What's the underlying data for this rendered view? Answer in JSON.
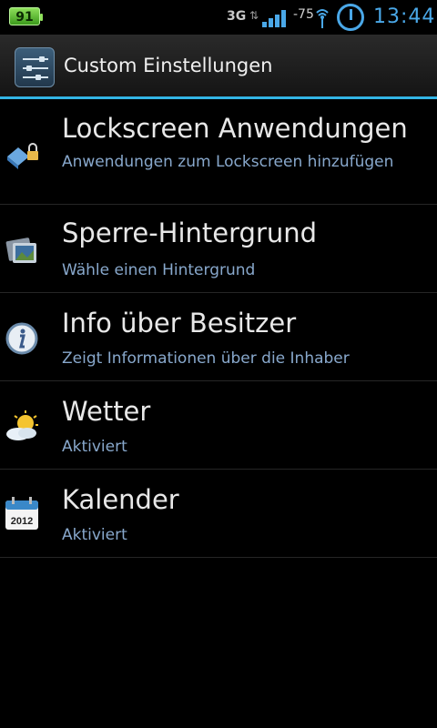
{
  "status_bar": {
    "battery": "91",
    "network_type": "3G",
    "signal_dbm": "-75",
    "time": "13:44",
    "icons": [
      "battery-icon",
      "data-arrows-icon",
      "signal-icon",
      "wifi-icon",
      "clock-widget-icon"
    ]
  },
  "header": {
    "title": "Custom Einstellungen",
    "icon": "settings-sliders-icon",
    "accent_color": "#33b5e5"
  },
  "settings": {
    "items": [
      {
        "title": "Lockscreen Anwendungen",
        "subtitle": "Anwendungen zum Lockscreen hinzufügen",
        "icon": "lockscreen-apps-icon"
      },
      {
        "title": "Sperre-Hintergrund",
        "subtitle": "Wähle einen Hintergrund",
        "icon": "wallpaper-icon"
      },
      {
        "title": "Info über Besitzer",
        "subtitle": "Zeigt Informationen über die Inhaber",
        "icon": "info-icon"
      },
      {
        "title": "Wetter",
        "subtitle": "Aktiviert",
        "icon": "weather-icon"
      },
      {
        "title": "Kalender",
        "subtitle": "Aktiviert",
        "icon": "calendar-icon",
        "icon_text": "2012"
      }
    ]
  }
}
